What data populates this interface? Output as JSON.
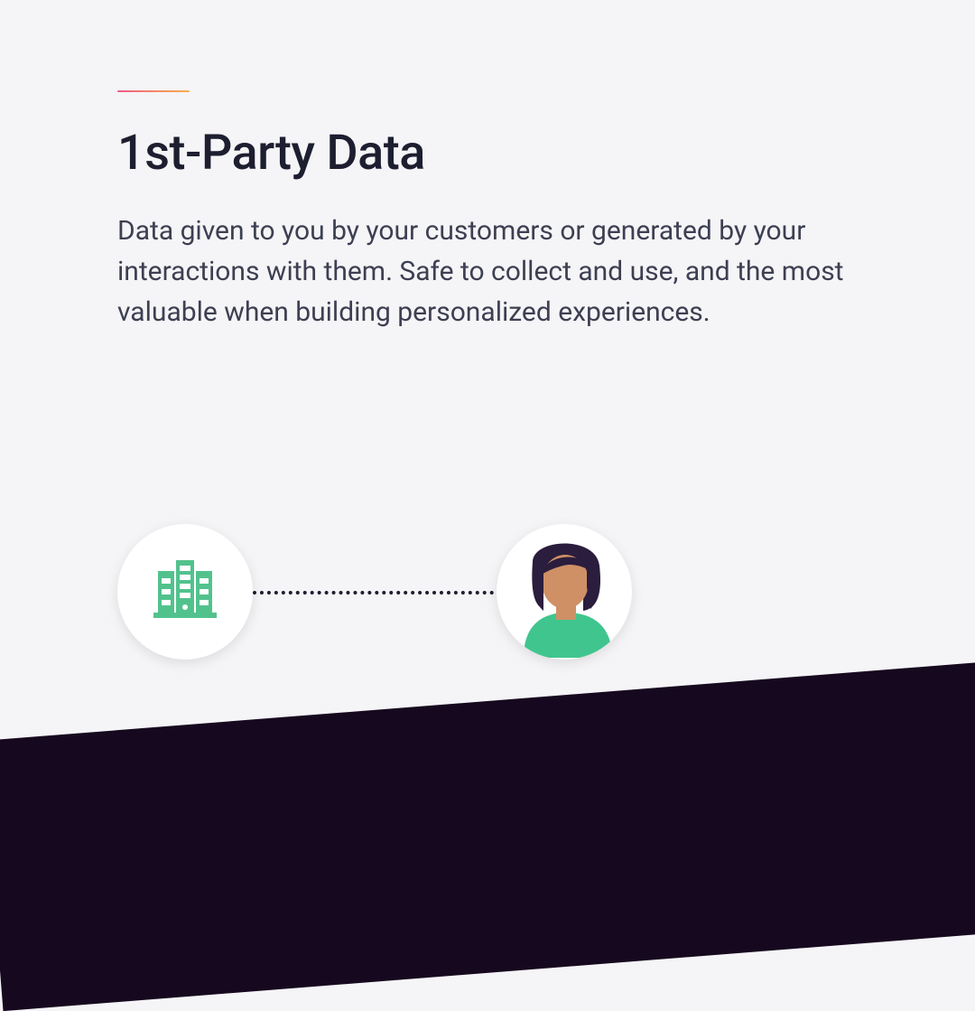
{
  "content": {
    "heading": "1st-Party Data",
    "body": "Data given to you by your customers or generated by your interactions with them. Safe to collect and use, and the most valuable when building personalized experiences."
  },
  "graphic": {
    "left_icon": "building-icon",
    "right_icon": "customer-avatar-icon"
  },
  "palette": {
    "accent_green": "#52c28d",
    "skin": "#cf9066",
    "hair": "#2b1d3d",
    "shirt": "#41c58e",
    "bg": "#f5f4f6",
    "dark": "#16091f",
    "pink": "#f0958e"
  }
}
